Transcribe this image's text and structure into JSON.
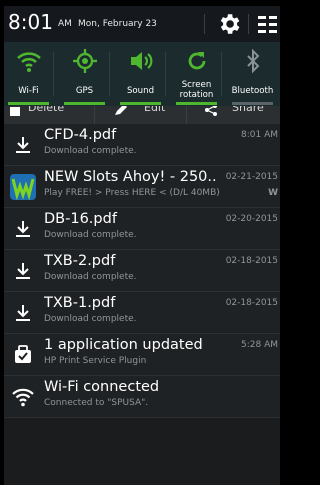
{
  "status_bar": {
    "time": "8:01",
    "ampm": "AM",
    "date": "Mon, February 23",
    "icons": [
      "gear-icon",
      "grid-icon"
    ]
  },
  "quick_settings": [
    {
      "label": "Wi-Fi",
      "icon": "wifi-icon",
      "on": true
    },
    {
      "label": "GPS",
      "icon": "gps-icon",
      "on": true
    },
    {
      "label": "Sound",
      "icon": "sound-icon",
      "on": true
    },
    {
      "label": "Screen rotation",
      "icon": "rotation-icon",
      "on": true
    },
    {
      "label": "Bluetooth",
      "icon": "bluetooth-icon",
      "on": false
    }
  ],
  "actions": [
    "Delete",
    "Edit",
    "Share"
  ],
  "notifications": [
    {
      "icon": "download-icon",
      "title": "CFD-4.pdf",
      "subtitle": "Download complete.",
      "time": "8:01 AM"
    },
    {
      "icon": "slots-app-icon",
      "title": "NEW Slots Ahoy! - 250..",
      "subtitle": "Play FREE! > Press HERE < (D/L 40MB)",
      "time": "02-21-2015",
      "extra": "W"
    },
    {
      "icon": "download-icon",
      "title": "DB-16.pdf",
      "subtitle": "Download complete.",
      "time": "02-20-2015"
    },
    {
      "icon": "download-icon",
      "title": "TXB-2.pdf",
      "subtitle": "Download complete.",
      "time": "02-18-2015"
    },
    {
      "icon": "download-icon",
      "title": "TXB-1.pdf",
      "subtitle": "Download complete.",
      "time": "02-18-2015"
    },
    {
      "icon": "app-update-icon",
      "title": "1 application updated",
      "subtitle": "HP Print Service Plugin",
      "time": "5:28 AM"
    },
    {
      "icon": "wifi-icon",
      "title": "Wi-Fi connected",
      "subtitle": "Connected to \"SPUSA\"."
    }
  ],
  "colors": {
    "accent_green": "#4fb72f",
    "shade_bg": "#1f2224",
    "secondary_text": "#8f959a"
  }
}
